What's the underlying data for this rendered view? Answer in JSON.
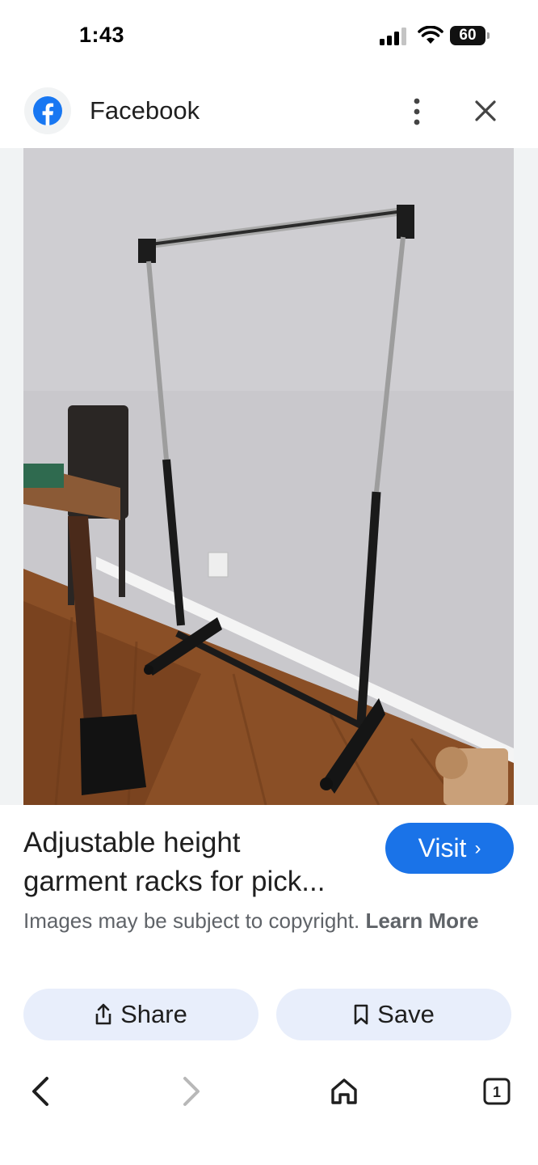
{
  "status_bar": {
    "time": "1:43",
    "battery": "60"
  },
  "header": {
    "site_name": "Facebook",
    "icons": [
      "facebook-logo-icon",
      "more-vert-icon",
      "close-icon"
    ]
  },
  "image": {
    "subject": "black adjustable garment rack in room"
  },
  "result": {
    "title_line1": "Adjustable height",
    "title_line2": "garment racks for pick...",
    "visit_label": "Visit",
    "copyright_text": "Images may be subject to copyright.",
    "learn_more": "Learn More"
  },
  "actions": {
    "share_label": "Share",
    "save_label": "Save"
  },
  "nav": {
    "tab_count": "1"
  },
  "colors": {
    "accent": "#1a73e8",
    "pill_bg": "#e8eefb",
    "facebook": "#1877f2"
  }
}
